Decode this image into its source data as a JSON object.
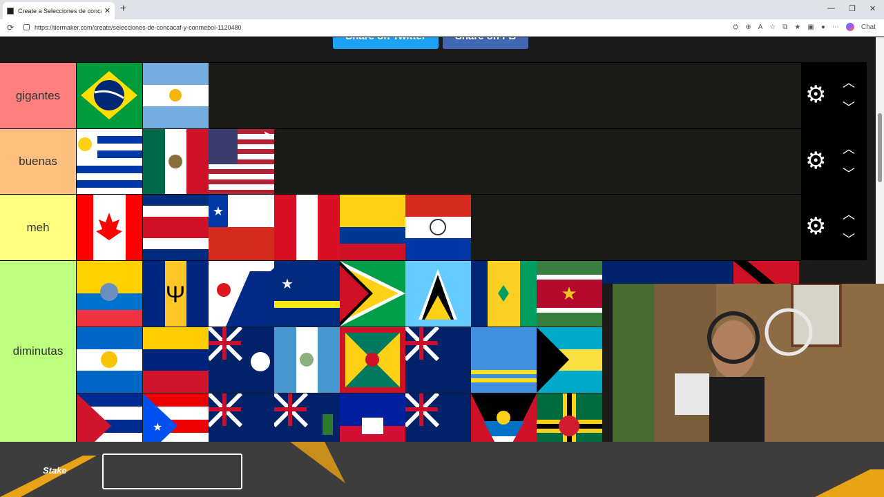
{
  "browser": {
    "tab_title": "Create a Selecciones de concacaf y",
    "url": "https://tiermaker.com/create/selecciones-de-concacaf-y-conmebol-1120480",
    "chat_label": "Chat"
  },
  "share": {
    "twitter_label": "Share on Twitter",
    "fb_label": "Share on FB"
  },
  "tiers": [
    {
      "label": "gigantes",
      "color": "#ff7f7f"
    },
    {
      "label": "buenas",
      "color": "#ffbf7f"
    },
    {
      "label": "meh",
      "color": "#ffff7f"
    },
    {
      "label": "diminutas",
      "color": "#bfff7f"
    }
  ],
  "overlay": {
    "brand": "Stake"
  },
  "icons": {
    "gear": "gear-icon",
    "up": "chevron-up-icon",
    "down": "chevron-down-icon"
  }
}
